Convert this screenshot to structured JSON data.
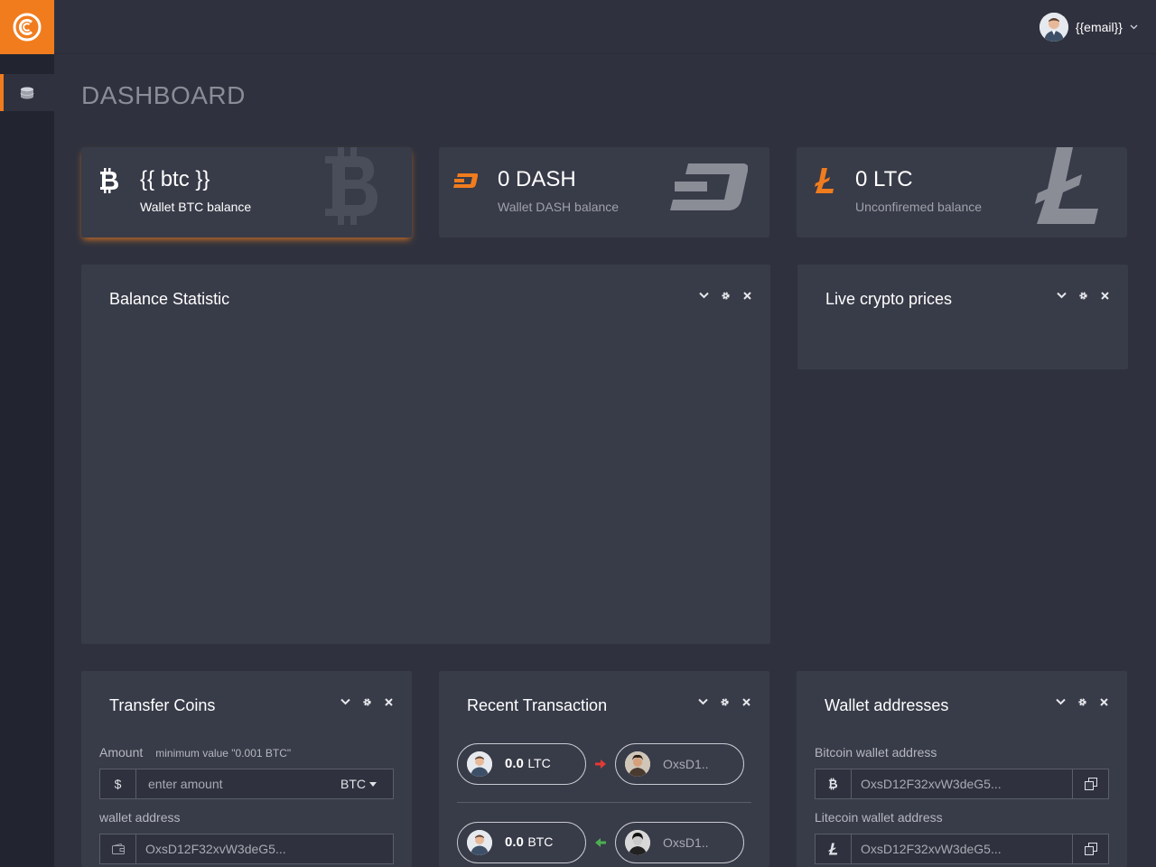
{
  "header": {
    "user_email": "{{email}}"
  },
  "page": {
    "title": "DASHBOARD"
  },
  "balances": {
    "btc": {
      "value": "{{ btc }}",
      "label": "Wallet BTC balance"
    },
    "dash": {
      "value": "0 DASH",
      "label": "Wallet DASH balance"
    },
    "ltc": {
      "value": "0 LTC",
      "label": "Unconfiremed balance"
    }
  },
  "panels": {
    "balance_statistic": {
      "title": "Balance Statistic"
    },
    "live_prices": {
      "title": "Live crypto prices"
    },
    "transfer": {
      "title": "Transfer Coins",
      "amount_label": "Amount",
      "amount_hint": "minimum value \"0.001 BTC\"",
      "currency_symbol": "$",
      "amount_placeholder": "enter amount",
      "currency": "BTC",
      "wallet_label": "wallet address",
      "wallet_value": "OxsD12F32xvW3deG5..."
    },
    "recent": {
      "title": "Recent Transaction",
      "transactions": [
        {
          "amount": "0.0",
          "currency": "LTC",
          "address": "OxsD1..",
          "direction": "out"
        },
        {
          "amount": "0.0",
          "currency": "BTC",
          "address": "OxsD1..",
          "direction": "in"
        }
      ]
    },
    "wallets": {
      "title": "Wallet addresses",
      "btc_label": "Bitcoin wallet address",
      "btc_address": "OxsD12F32xvW3deG5...",
      "ltc_label": "Litecoin wallet address",
      "ltc_address": "OxsD12F32xvW3deG5..."
    }
  },
  "colors": {
    "accent": "#f07c1e",
    "arrow_out": "#e53935",
    "arrow_in": "#4caf50"
  }
}
